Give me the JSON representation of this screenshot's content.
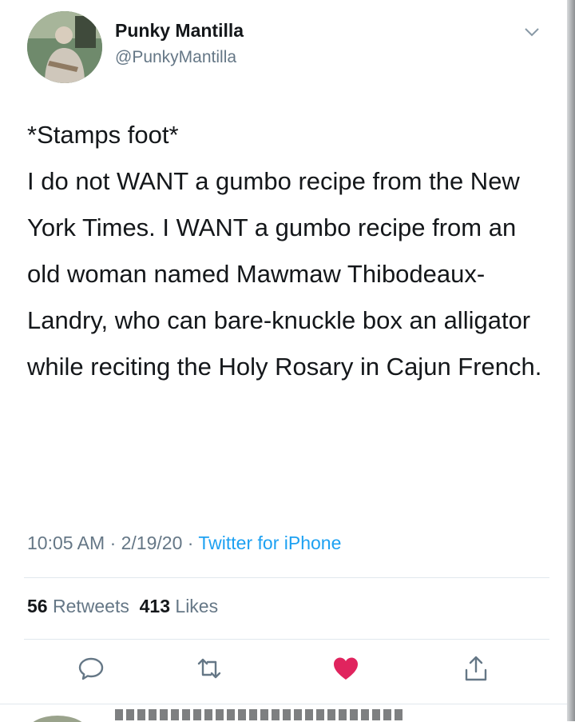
{
  "user": {
    "name": "Punky Mantilla",
    "handle": "@PunkyMantilla"
  },
  "tweet": {
    "line1": "*Stamps foot*",
    "body": "I do not WANT a gumbo recipe from the New York Times. I WANT a gumbo recipe from an old woman named Mawmaw Thibodeaux-Landry, who can bare-knuckle box an alligator while reciting the Holy Rosary in Cajun French.",
    "timestamp": "10:05 AM · 2/19/20 · ",
    "source": "Twitter for iPhone"
  },
  "stats": {
    "retweets_count": "56",
    "retweets_label": "Retweets",
    "likes_count": "413",
    "likes_label": "Likes"
  },
  "actions": [
    {
      "icon": "reply-icon"
    },
    {
      "icon": "retweet-icon"
    },
    {
      "icon": "like-icon",
      "liked": true
    },
    {
      "icon": "share-icon"
    }
  ],
  "colors": {
    "link": "#1da1f2",
    "secondary": "#657786",
    "like": "#e0245e"
  }
}
